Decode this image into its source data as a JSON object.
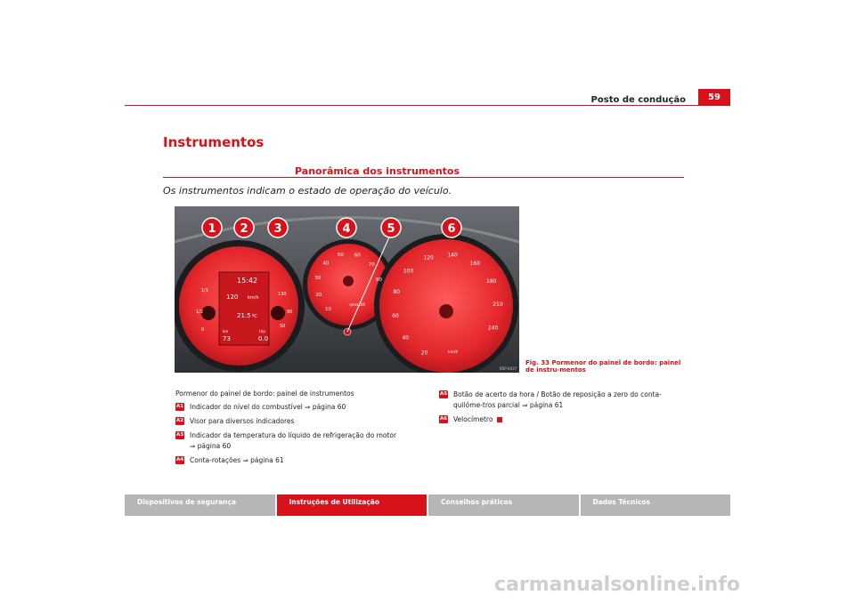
{
  "header": {
    "title": "Posto de condução",
    "page_number": "59"
  },
  "section": {
    "title": "Instrumentos",
    "subtitle": "Panorâmica dos instrumentos",
    "intro": "Os instrumentos indicam o estado de operação do veículo."
  },
  "figure": {
    "callouts": [
      "1",
      "2",
      "3",
      "4",
      "5",
      "6"
    ],
    "code": "B5P-0437",
    "caption": "Fig. 33   Pormenor do painel de bordo: painel de instru-mentos",
    "display": {
      "time": "15:42",
      "speed": "120",
      "speed_unit": "km/h",
      "temp": "21.5",
      "temp_unit": "ºC",
      "odo": "73",
      "trip": "0.0",
      "odo_label": "km",
      "trip_label": "trip",
      "fuel_full": "1/1",
      "fuel_half": "1/2",
      "fuel_empty": "0",
      "temp_hi": "130",
      "temp_mid": "90",
      "temp_lo": "50"
    },
    "rpm": {
      "ticks": [
        "10",
        "20",
        "30",
        "40",
        "50",
        "60",
        "70",
        "80"
      ],
      "unit": "rpmx100"
    },
    "speedo": {
      "ticks": [
        "20",
        "40",
        "60",
        "80",
        "100",
        "120",
        "140",
        "160",
        "180",
        "210",
        "240"
      ],
      "unit": "km/h"
    }
  },
  "legend": {
    "lead": "Pormenor do painel de bordo: painel de instrumentos",
    "items": [
      {
        "badge": "A1",
        "text": "Indicador do nível do combustível ⇒ página 60"
      },
      {
        "badge": "A2",
        "text": "Visor para diversos indicadores"
      },
      {
        "badge": "A3",
        "text": "Indicador da temperatura do líquido de refrigeração do motor ⇒ página 60"
      },
      {
        "badge": "A4",
        "text": "Conta-rotações ⇒ página 61"
      },
      {
        "badge": "A5",
        "text": "Botão de acerto da hora / Botão de reposição a zero do conta-quilóme-tros parcial ⇒ página 61"
      },
      {
        "badge": "A6",
        "text": "Velocímetro"
      }
    ]
  },
  "footer": {
    "tabs": [
      "Dispositivos de segurança",
      "Instruções de Utilização",
      "Conselhos práticos",
      "Dados Técnicos"
    ],
    "active": 1
  },
  "watermark": "carmanualsonline.info",
  "colors": {
    "accent": "#d8121a",
    "tab": "#b6b6b6",
    "panel": "#3a3d42"
  }
}
